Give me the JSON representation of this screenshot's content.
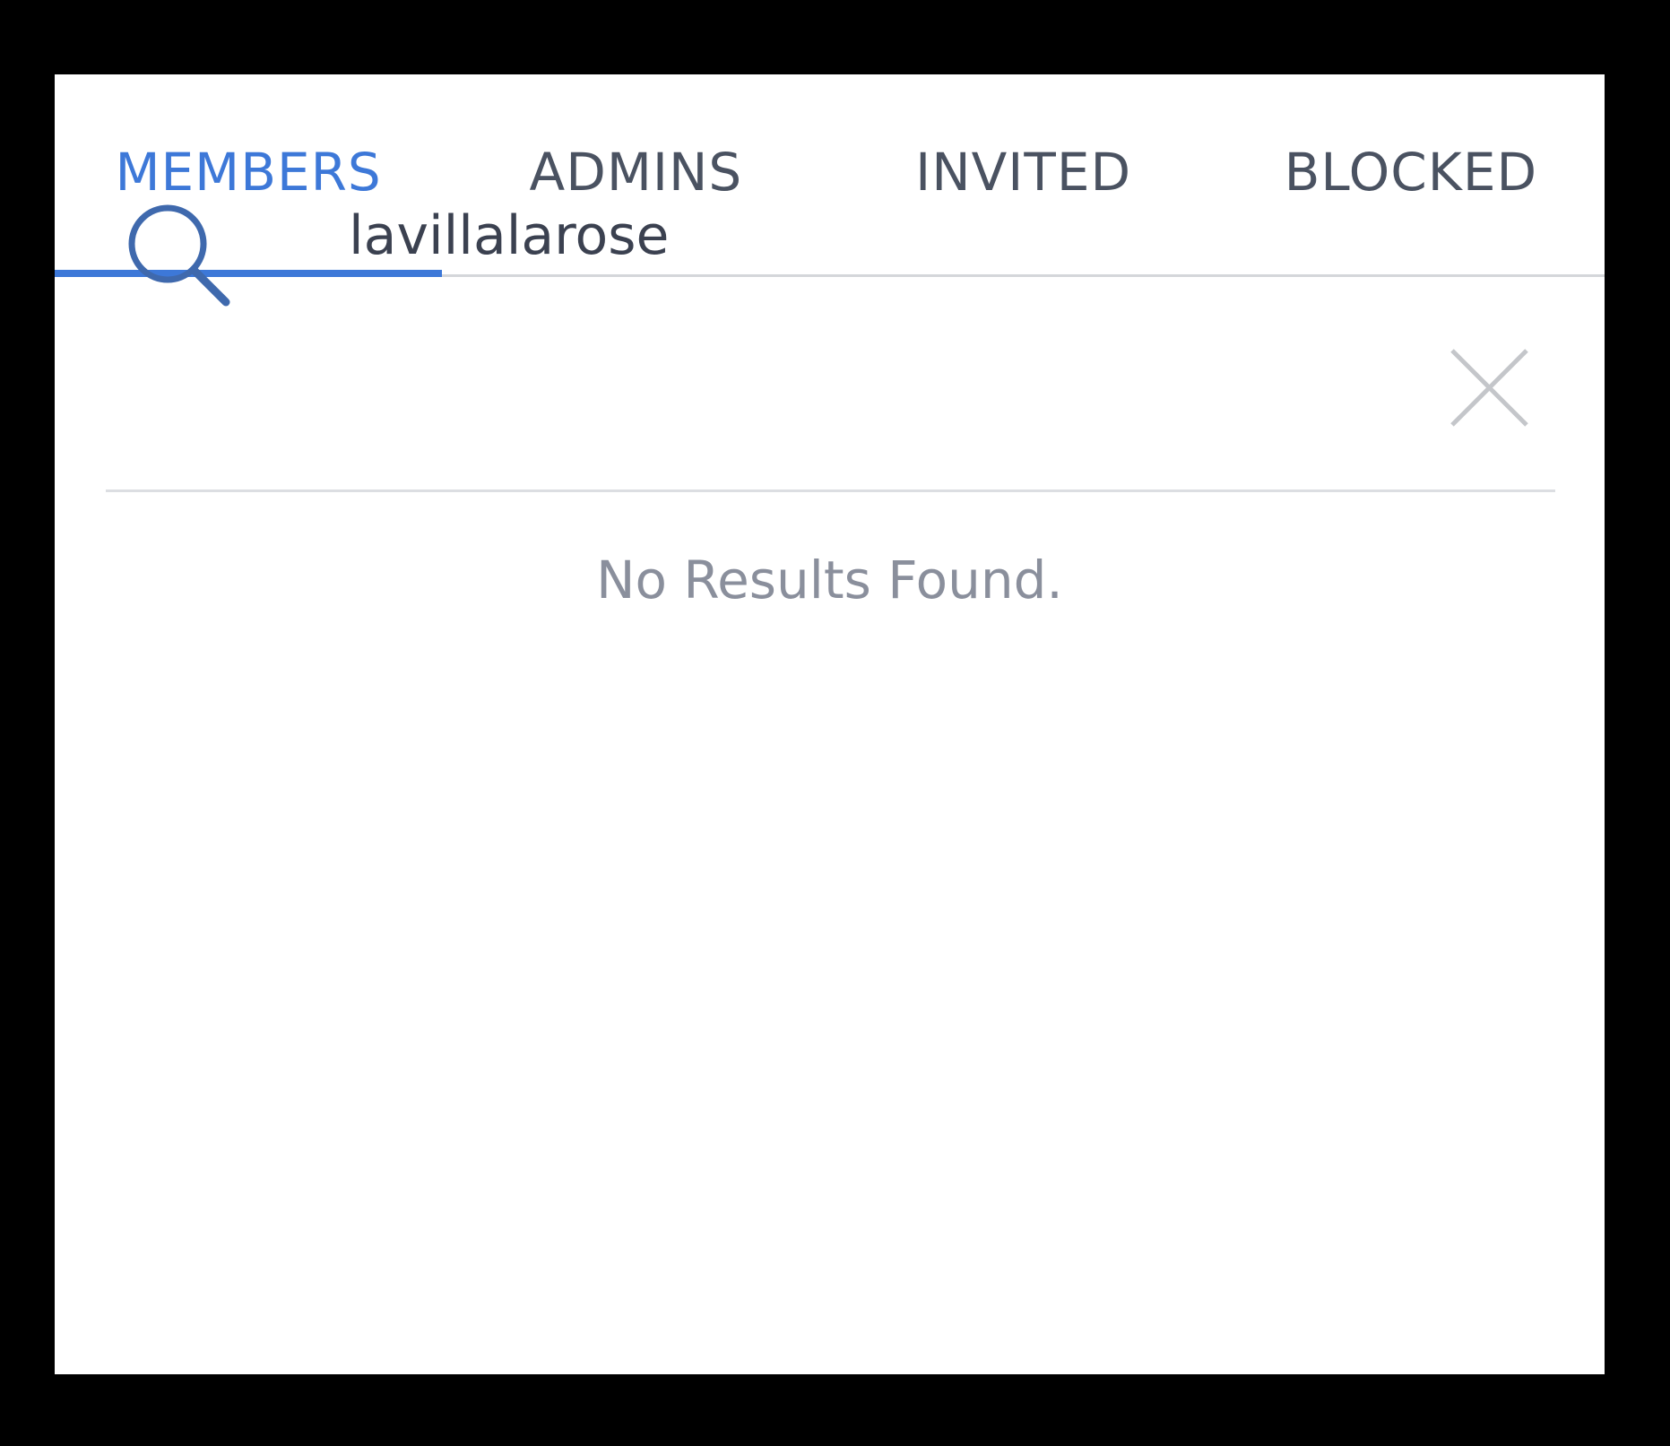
{
  "tabs": [
    {
      "label": "MEMBERS",
      "active": true
    },
    {
      "label": "ADMINS",
      "active": false
    },
    {
      "label": "INVITED",
      "active": false
    },
    {
      "label": "BLOCKED",
      "active": false
    }
  ],
  "search": {
    "value": "lavillalarose",
    "icon": "search-icon",
    "clear_icon": "close-icon"
  },
  "results": {
    "empty_message": "No Results Found."
  },
  "colors": {
    "accent": "#3d78d8",
    "tab_text": "#4a5261",
    "empty_text": "#8a8f9c"
  }
}
